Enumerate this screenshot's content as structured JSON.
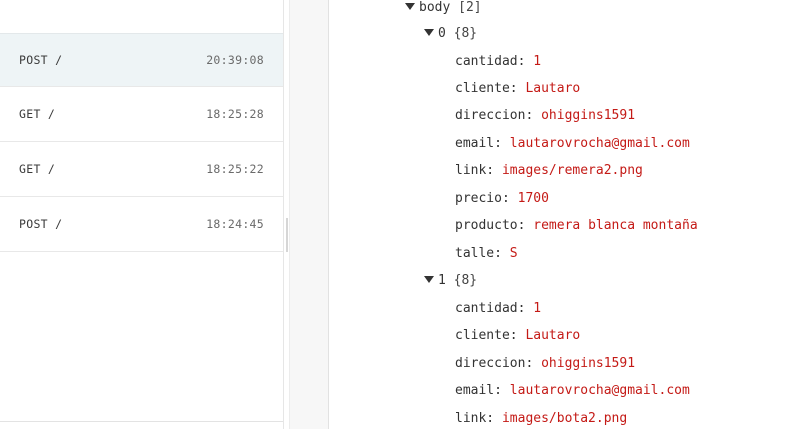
{
  "requests": [
    {
      "method": "POST /",
      "time": "20:39:08",
      "selected": true
    },
    {
      "method": "GET /",
      "time": "18:25:28",
      "selected": false
    },
    {
      "method": "GET /",
      "time": "18:25:22",
      "selected": false
    },
    {
      "method": "POST /",
      "time": "18:24:45",
      "selected": false
    }
  ],
  "tree": {
    "root_key": "body",
    "root_count": "[2]",
    "items": [
      {
        "index": "0",
        "count": "{8}",
        "fields": [
          {
            "key": "cantidad:",
            "value": "1"
          },
          {
            "key": "cliente:",
            "value": "Lautaro"
          },
          {
            "key": "direccion:",
            "value": "ohiggins1591"
          },
          {
            "key": "email:",
            "value": "lautarovrocha@gmail.com"
          },
          {
            "key": "link:",
            "value": "images/remera2.png"
          },
          {
            "key": "precio:",
            "value": "1700"
          },
          {
            "key": "producto:",
            "value": "remera blanca montaña"
          },
          {
            "key": "talle:",
            "value": "S"
          }
        ]
      },
      {
        "index": "1",
        "count": "{8}",
        "fields": [
          {
            "key": "cantidad:",
            "value": "1"
          },
          {
            "key": "cliente:",
            "value": "Lautaro"
          },
          {
            "key": "direccion:",
            "value": "ohiggins1591"
          },
          {
            "key": "email:",
            "value": "lautarovrocha@gmail.com"
          },
          {
            "key": "link:",
            "value": "images/bota2.png"
          }
        ]
      }
    ]
  },
  "colors": {
    "value_red": "#c41a16",
    "selected_bg": "#eef4f6",
    "gutter_bg": "#f7f7f7"
  },
  "icons": {
    "toggle": "triangle-down-icon"
  }
}
